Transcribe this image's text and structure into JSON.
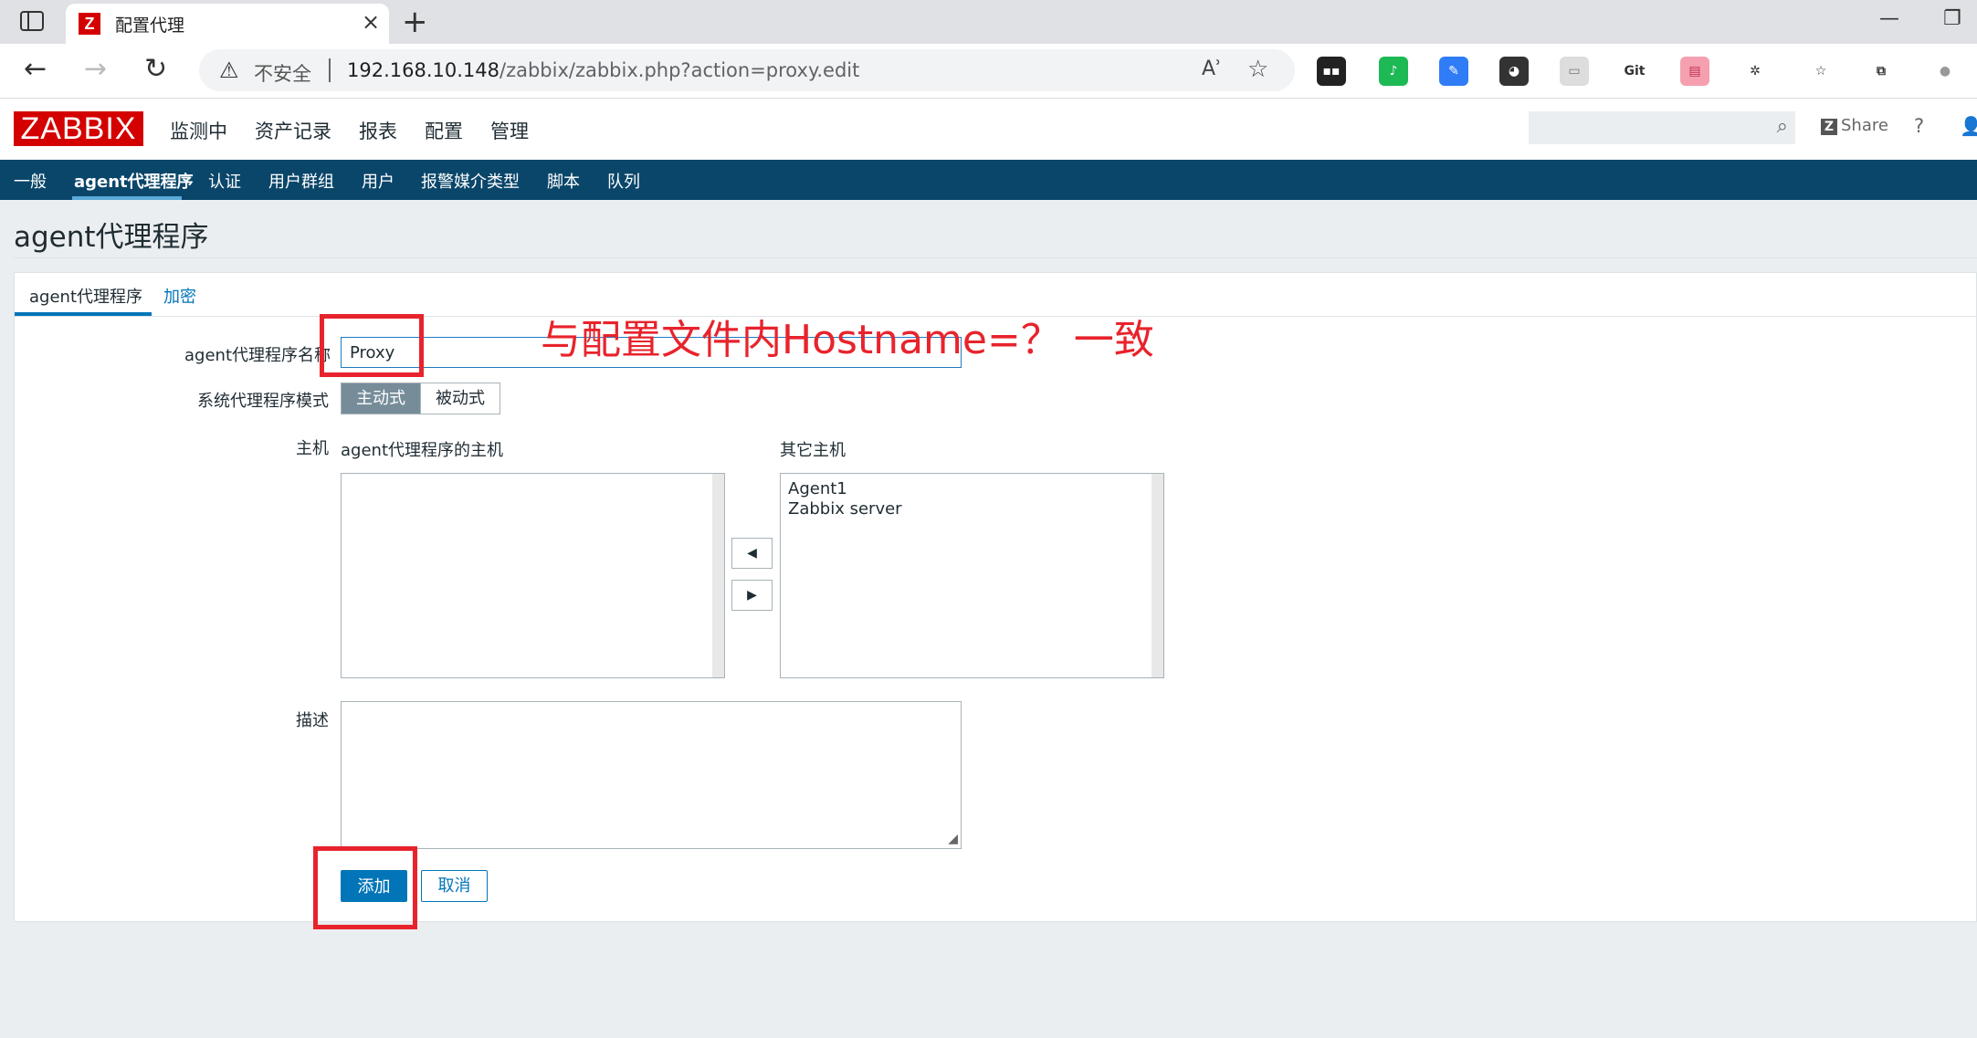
{
  "browser": {
    "tab_title": "配置代理",
    "tab_favicon": "Z",
    "tab_close": "×",
    "new_tab": "+",
    "insecure_label": "不安全",
    "url_host": "192.168.10.148",
    "url_path": "/zabbix/zabbix.php?action=proxy.edit",
    "read_aloud": "Aʾ",
    "extensions": [
      {
        "name": "tampermonkey-icon",
        "text": "▪▪",
        "bg": "#222222",
        "fg": "#ffffff"
      },
      {
        "name": "audio-icon",
        "text": "♪",
        "bg": "#1db954",
        "fg": "#ffffff"
      },
      {
        "name": "edit-icon",
        "text": "✎",
        "bg": "#2f7cf6",
        "fg": "#ffffff"
      },
      {
        "name": "ghost-icon",
        "text": "◕",
        "bg": "#333333",
        "fg": "#ffffff"
      },
      {
        "name": "screen-icon",
        "text": "▭",
        "bg": "#dddddd",
        "fg": "#777777"
      },
      {
        "name": "gitzip-icon",
        "text": "Git",
        "bg": "#ffffff",
        "fg": "#333333"
      },
      {
        "name": "media-icon",
        "text": "▤",
        "bg": "#f4a0b0",
        "fg": "#c03050"
      },
      {
        "name": "puzzle-icon",
        "text": "✲",
        "bg": "#ffffff",
        "fg": "#333333"
      },
      {
        "name": "favorites-icon",
        "text": "☆",
        "bg": "#ffffff",
        "fg": "#333333"
      },
      {
        "name": "collections-icon",
        "text": "⧉",
        "bg": "#ffffff",
        "fg": "#333333"
      },
      {
        "name": "profile-icon",
        "text": "●",
        "bg": "#ffffff",
        "fg": "#999999"
      }
    ]
  },
  "header": {
    "logo": "ZABBIX",
    "menu": [
      "监测中",
      "资产记录",
      "报表",
      "配置",
      "管理"
    ],
    "share": "Share",
    "share_icon": "Z",
    "help": "?"
  },
  "submenu": [
    "一般",
    "agent代理程序",
    "认证",
    "用户群组",
    "用户",
    "报警媒介类型",
    "脚本",
    "队列"
  ],
  "page_title": "agent代理程序",
  "form": {
    "tabs": [
      "agent代理程序",
      "加密"
    ],
    "name_label": "agent代理程序名称",
    "name_value": "Proxy",
    "mode_label": "系统代理程序模式",
    "mode_active": "主动式",
    "mode_passive": "被动式",
    "hosts_label": "主机",
    "proxy_hosts_label": "agent代理程序的主机",
    "other_hosts_label": "其它主机",
    "other_hosts": [
      "Agent1",
      "Zabbix server"
    ],
    "move_left": "◀",
    "move_right": "▶",
    "desc_label": "描述",
    "add_button": "添加",
    "cancel_button": "取消"
  },
  "annotation": "与配置文件内Hostname=？ 一致",
  "colors": {
    "accent": "#0275b8",
    "nav": "#0a466a",
    "logo": "#d40000",
    "annotation": "#e8232c"
  }
}
